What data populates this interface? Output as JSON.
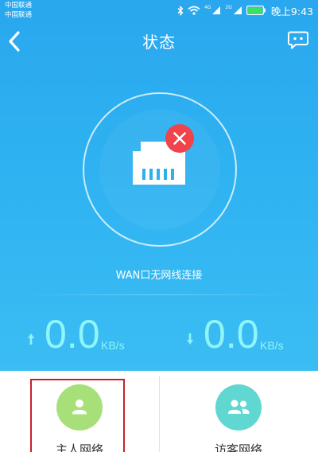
{
  "status_bar": {
    "carrier_line1": "中国联通",
    "carrier_line2": "中国联通",
    "time": "晚上9:43",
    "icons": [
      "bluetooth-icon",
      "wifi-icon",
      "signal-4g-icon",
      "signal-2g-icon",
      "battery-icon"
    ],
    "net_label_1": "4G",
    "net_label_2": "2G"
  },
  "header": {
    "title": "状态",
    "back_icon": "chevron-left-icon",
    "chat_icon": "chat-bubble-icon"
  },
  "connection": {
    "status_text": "WAN口无网线连接",
    "icon": "ethernet-port-icon",
    "badge_icon": "close-icon",
    "badge_color": "#f0434b"
  },
  "speeds": {
    "upload": {
      "value": "0.0",
      "unit": "KB/s",
      "icon": "arrow-up-icon"
    },
    "download": {
      "value": "0.0",
      "unit": "KB/s",
      "icon": "arrow-down-icon"
    }
  },
  "tabs": [
    {
      "label": "主人网络",
      "icon": "user-icon",
      "color": "#a7e079"
    },
    {
      "label": "访客网络",
      "icon": "users-icon",
      "color": "#61d7d1"
    }
  ],
  "colors": {
    "header_gradient_top": "#2aa7ee",
    "header_gradient_bottom": "#3bbdf3",
    "speed_text": "#8ff5f8",
    "highlight": "#c7202a"
  }
}
